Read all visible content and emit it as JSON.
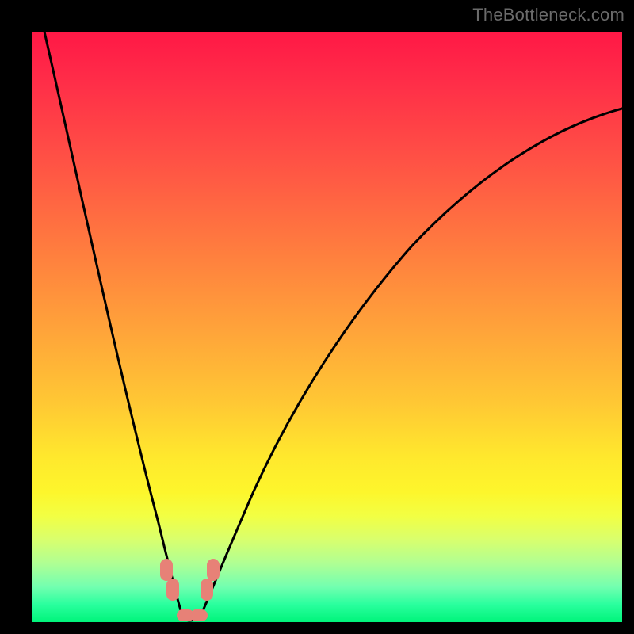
{
  "watermark": "TheBottleneck.com",
  "colors": {
    "marker": "#e78177",
    "curve": "#000000",
    "frame": "#000000"
  },
  "chart_data": {
    "type": "line",
    "title": "",
    "xlabel": "",
    "ylabel": "",
    "xlim": [
      0,
      100
    ],
    "ylim": [
      0,
      100
    ],
    "series": [
      {
        "name": "left-branch",
        "x": [
          2,
          4,
          6,
          8,
          10,
          12,
          14,
          16,
          18,
          20,
          21.5,
          23,
          24.3
        ],
        "y": [
          100,
          89,
          78,
          68,
          58,
          49,
          40,
          32,
          24,
          16.5,
          11,
          6,
          1.5
        ]
      },
      {
        "name": "valley",
        "x": [
          24.3,
          25.2,
          26.5,
          27.8,
          28.7
        ],
        "y": [
          1.5,
          0.3,
          0,
          0.3,
          1.5
        ]
      },
      {
        "name": "right-branch",
        "x": [
          28.7,
          30.5,
          33,
          36,
          40,
          45,
          50,
          56,
          63,
          71,
          80,
          90,
          100
        ],
        "y": [
          1.5,
          6.5,
          13,
          21,
          30,
          39,
          47,
          54.5,
          62,
          69,
          75.5,
          81.5,
          87
        ]
      }
    ],
    "markers": [
      {
        "name": "left-cluster-1",
        "approx_x": 22.8,
        "approx_y": 7.5
      },
      {
        "name": "left-cluster-2",
        "approx_x": 23.7,
        "approx_y": 4.0
      },
      {
        "name": "floor-1",
        "approx_x": 25.5,
        "approx_y": 0.3
      },
      {
        "name": "floor-2",
        "approx_x": 27.5,
        "approx_y": 0.3
      },
      {
        "name": "right-cluster-1",
        "approx_x": 29.3,
        "approx_y": 4.0
      },
      {
        "name": "right-cluster-2",
        "approx_x": 30.2,
        "approx_y": 7.5
      }
    ],
    "gradient_stops": [
      {
        "pos": 0,
        "color": "#ff1846"
      },
      {
        "pos": 50,
        "color": "#ffa23a"
      },
      {
        "pos": 78,
        "color": "#fdf62c"
      },
      {
        "pos": 100,
        "color": "#00f47a"
      }
    ]
  }
}
